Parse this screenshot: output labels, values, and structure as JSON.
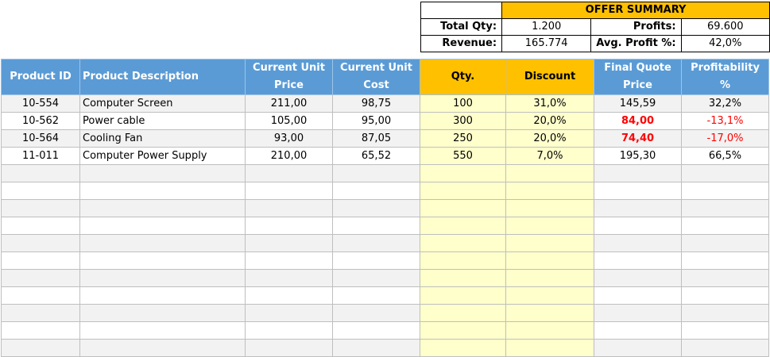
{
  "summary": {
    "title": "OFFER SUMMARY",
    "total_qty_label": "Total Qty:",
    "total_qty_value": "1.200",
    "profits_label": "Profits:",
    "profits_value": "69.600",
    "revenue_label": "Revenue:",
    "revenue_value": "165.774",
    "avg_profit_label": "Avg. Profit %:",
    "avg_profit_value": "42,0%"
  },
  "headers": {
    "product_id": "Product ID",
    "product_description": "Product Description",
    "current_unit_price_1": "Current Unit",
    "current_unit_price_2": "Price",
    "current_unit_cost_1": "Current Unit",
    "current_unit_cost_2": "Cost",
    "qty": "Qty.",
    "discount": "Discount",
    "final_quote_price_1": "Final Quote",
    "final_quote_price_2": "Price",
    "profitability_1": "Profitability",
    "profitability_2": "%"
  },
  "rows": [
    {
      "id": "10-554",
      "desc": "Computer Screen",
      "price": "211,00",
      "cost": "98,75",
      "qty": "100",
      "discount": "31,0%",
      "final": "145,59",
      "profit": "32,2%"
    },
    {
      "id": "10-562",
      "desc": "Power cable",
      "price": "105,00",
      "cost": "95,00",
      "qty": "300",
      "discount": "20,0%",
      "final": "84,00",
      "profit": "-13,1%"
    },
    {
      "id": "10-564",
      "desc": "Cooling Fan",
      "price": "93,00",
      "cost": "87,05",
      "qty": "250",
      "discount": "20,0%",
      "final": "74,40",
      "profit": "-17,0%"
    },
    {
      "id": "11-011",
      "desc": "Computer Power Supply",
      "price": "210,00",
      "cost": "65,52",
      "qty": "550",
      "discount": "7,0%",
      "final": "195,30",
      "profit": "66,5%"
    }
  ],
  "colors": {
    "header_blue": "#5b9bd5",
    "header_yellow": "#ffc000",
    "input_yellow": "#ffffcc",
    "negative_red": "#ff0000"
  }
}
